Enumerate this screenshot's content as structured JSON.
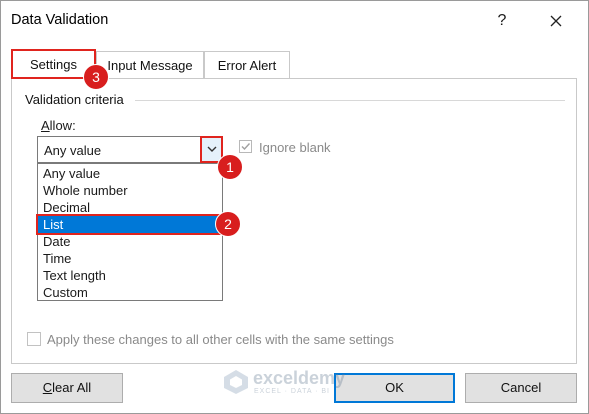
{
  "window": {
    "title": "Data Validation",
    "help_label": "?",
    "close_icon": "close-icon"
  },
  "tabs": [
    {
      "label": "Settings",
      "active": true
    },
    {
      "label": "Input Message",
      "active": false
    },
    {
      "label": "Error Alert",
      "active": false
    }
  ],
  "criteria": {
    "group_label": "Validation criteria",
    "allow_label_underlined": "A",
    "allow_label_rest": "llow:",
    "allow_value": "Any value",
    "ignore_blank_label": "Ignore blank",
    "ignore_blank_checked": true,
    "options": [
      {
        "label": "Any value",
        "selected": false
      },
      {
        "label": "Whole number",
        "selected": false
      },
      {
        "label": "Decimal",
        "selected": false
      },
      {
        "label": "List",
        "selected": true
      },
      {
        "label": "Date",
        "selected": false
      },
      {
        "label": "Time",
        "selected": false
      },
      {
        "label": "Text length",
        "selected": false
      },
      {
        "label": "Custom",
        "selected": false
      }
    ]
  },
  "apply_all": {
    "label": "Apply these changes to all other cells with the same settings",
    "checked": false
  },
  "buttons": {
    "clear_underlined": "C",
    "clear_rest": "lear All",
    "ok": "OK",
    "cancel": "Cancel"
  },
  "annotations": {
    "badge_1": "1",
    "badge_2": "2",
    "badge_3": "3",
    "highlight_color": "#e0241e",
    "badge_color": "#d81e1e",
    "selection_color": "#0078d7"
  },
  "watermark": {
    "name": "exceldemy",
    "tagline": "EXCEL · DATA · BI"
  }
}
